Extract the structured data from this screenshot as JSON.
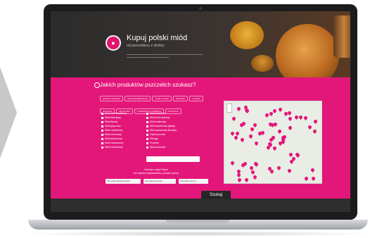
{
  "hero": {
    "title": "Kupuj polski miód",
    "subtitle": "od pszczelarzy z okolicy"
  },
  "search": {
    "question": "Jakich produktów pszczelich szukasz?",
    "tags": [
      "pierwszy wiosenny",
      "letni wieloskładnikowy",
      "miody z karpat",
      "ogrodowy",
      "z pasieki",
      "sezonowy",
      "dla zdrowia",
      "z ekologiczną certyfikacją",
      "prezentowy"
    ],
    "left_column": [
      "Miód wielokwiatowy",
      "Miód akacjowy",
      "Miód lipowy",
      "Miód gryczany",
      "Miód rzepakowy",
      "Miód wrzosowy",
      "Miód spadziowy",
      "Miód nawłociowy",
      "Miód mniszkowy"
    ],
    "right_column": [
      "Miód faceliowy",
      "Miód koniczynowy",
      "Miód malinowy",
      "Miód spadziowy iglasty",
      "Miód spadziowy liściasty",
      "Pyłek pszczeli",
      "Pierzga",
      "Propolis",
      "Wosk pszczeli"
    ],
    "or_text_1": "Szukaj w całej Polsce",
    "or_text_2": "lub wybierz województwo, powiat i gminę",
    "select_region": "Wszystkie Województwa",
    "select_county": "Wszystkie Powiaty",
    "select_commune": "Wszystkie Gminy",
    "search_button": "Szukaj"
  },
  "colors": {
    "accent": "#e3177a",
    "dark": "#2b2a2a"
  }
}
